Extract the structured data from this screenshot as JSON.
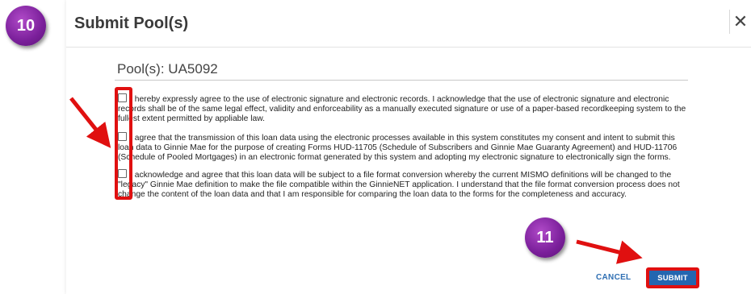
{
  "step_badges": {
    "first": "10",
    "second": "11"
  },
  "modal": {
    "title": "Submit Pool(s)",
    "close_glyph": "✕",
    "pool_line": "Pool(s): UA5092"
  },
  "agreements": [
    {
      "text": "I hereby expressly agree to the use of electronic signature and electronic records. I acknowledge that the use of electronic signature and electronic records shall be of the same legal effect, validity and enforceability as a manually executed signature or use of a paper-based recordkeeping system to the fullest extent permitted by appliable law."
    },
    {
      "text": "I agree that the transmission of this loan data using the electronic processes available in this system constitutes my consent and intent to submit this loan data to Ginnie Mae for the purpose of creating Forms HUD-11705 (Schedule of Subscribers and Ginnie Mae Guaranty Agreement) and HUD-11706 (Schedule of Pooled Mortgages) in an electronic format generated by this system and adopting my electronic signature to electronically sign the forms."
    },
    {
      "text": "I acknowledge and agree that this loan data will be subject to a file format conversion whereby the current MISMO definitions will be changed to the \"legacy\" Ginnie Mae definition to make the file compatible within the GinnieNET application. I understand that the file format conversion process does not change the content of the loan data and that I am responsible for comparing the loan data to the forms for the completeness and accuracy."
    }
  ],
  "actions": {
    "cancel_label": "CANCEL",
    "submit_label": "SUBMIT"
  },
  "colors": {
    "annotation_red": "#e01010",
    "badge_purple": "#7a1f9a",
    "primary_blue": "#2466b0",
    "link_blue": "#2f6fb3"
  }
}
